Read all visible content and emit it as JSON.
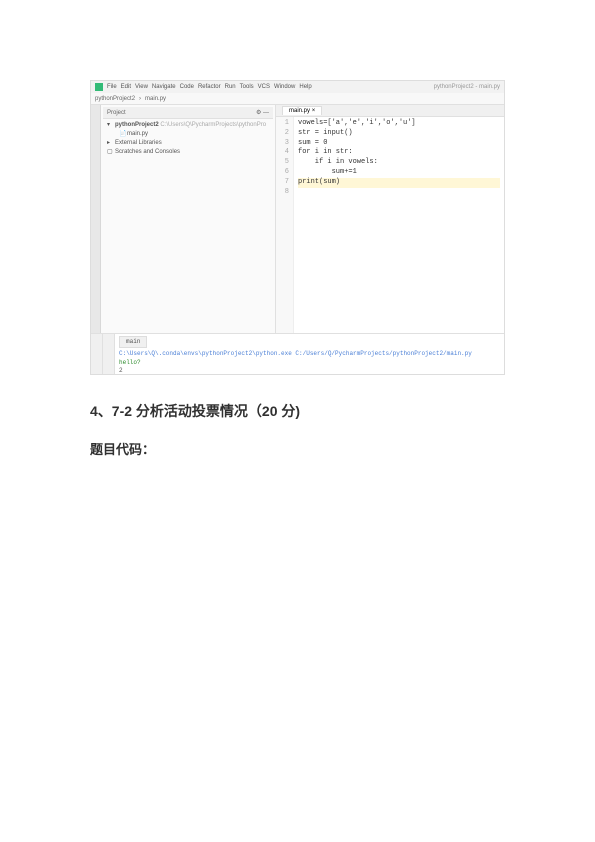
{
  "ide": {
    "menu": [
      "File",
      "Edit",
      "View",
      "Navigate",
      "Code",
      "Refactor",
      "Run",
      "Tools",
      "VCS",
      "Window",
      "Help"
    ],
    "title_suffix": "pythonProject2 - main.py",
    "crumbs": [
      "pythonProject2",
      "main.py"
    ],
    "sidebar_header": "Project",
    "tree": {
      "project": "pythonProject2",
      "project_path": "C:\\Users\\Q\\PycharmProjects\\pythonPro",
      "file": "main.py",
      "external": "External Libraries",
      "scratches": "Scratches and Consoles"
    },
    "tab": "main.py",
    "code": {
      "l1": "vowels=['a','e','i','o','u']",
      "l2": "str = input()",
      "l3": "sum = 0",
      "l4": "for i in str:",
      "l5": "    if i in vowels:",
      "l6": "        sum+=1",
      "l7": "",
      "l8": "print(sum)"
    },
    "gutter": [
      "1",
      "2",
      "3",
      "4",
      "5",
      "6",
      "7",
      "8"
    ],
    "console": {
      "tab": "main",
      "path": "C:\\Users\\Q\\.conda\\envs\\pythonProject2\\python.exe C:/Users/Q/PycharmProjects/pythonProject2/main.py",
      "input": "hello?",
      "out": "2"
    }
  },
  "article": {
    "heading": "4、7-2 分析活动投票情况（20 分)",
    "sub": "题目代码："
  }
}
